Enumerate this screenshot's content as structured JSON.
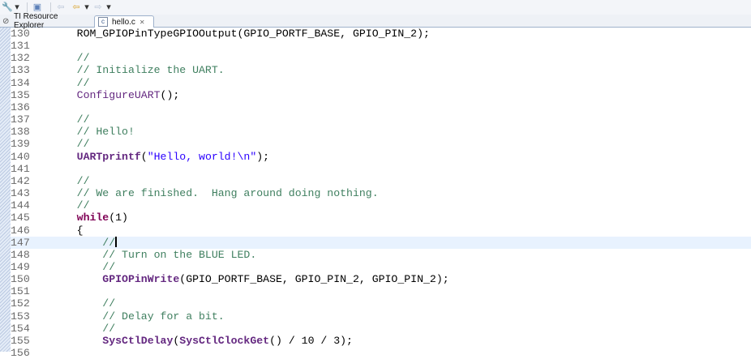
{
  "toolbar": {
    "items": [
      {
        "name": "pin-tool-icon",
        "glyph": "🔧"
      },
      {
        "name": "dropdown-chevron-icon",
        "glyph": "▾"
      },
      {
        "name": "show-whitespace-icon",
        "glyph": "▣"
      },
      {
        "name": "back-to-edit-icon",
        "glyph": "⇦"
      },
      {
        "name": "back-arrow-icon",
        "glyph": "⇦"
      },
      {
        "name": "back-dropdown-icon",
        "glyph": "▾"
      },
      {
        "name": "forward-arrow-icon",
        "glyph": "⇨"
      },
      {
        "name": "forward-dropdown-icon",
        "glyph": "▾"
      }
    ]
  },
  "tabs": [
    {
      "label": "TI Resource Explorer",
      "icon": "⊘",
      "active": false
    },
    {
      "label": "hello.c",
      "icon": "c",
      "close": "✕",
      "active": true
    }
  ],
  "editor": {
    "lines": [
      {
        "n": "130",
        "tokens": [
          {
            "t": "    ROM_GPIOPinTypeGPIOOutput(GPIO_PORTF_BASE, GPIO_PIN_2);",
            "c": "plain"
          }
        ]
      },
      {
        "n": "131",
        "tokens": []
      },
      {
        "n": "132",
        "tokens": [
          {
            "t": "    //",
            "c": "comment"
          }
        ]
      },
      {
        "n": "133",
        "tokens": [
          {
            "t": "    // Initialize the UART.",
            "c": "comment"
          }
        ]
      },
      {
        "n": "134",
        "tokens": [
          {
            "t": "    //",
            "c": "comment"
          }
        ]
      },
      {
        "n": "135",
        "tokens": [
          {
            "t": "    ConfigureUART",
            "c": "fn-plain"
          },
          {
            "t": "();",
            "c": "plain"
          }
        ]
      },
      {
        "n": "136",
        "tokens": []
      },
      {
        "n": "137",
        "tokens": [
          {
            "t": "    //",
            "c": "comment"
          }
        ]
      },
      {
        "n": "138",
        "tokens": [
          {
            "t": "    // Hello!",
            "c": "comment"
          }
        ]
      },
      {
        "n": "139",
        "tokens": [
          {
            "t": "    //",
            "c": "comment"
          }
        ]
      },
      {
        "n": "140",
        "tokens": [
          {
            "t": "    UARTprintf",
            "c": "fn"
          },
          {
            "t": "(",
            "c": "plain"
          },
          {
            "t": "\"Hello, world!\\n\"",
            "c": "str"
          },
          {
            "t": ");",
            "c": "plain"
          }
        ]
      },
      {
        "n": "141",
        "tokens": []
      },
      {
        "n": "142",
        "tokens": [
          {
            "t": "    //",
            "c": "comment"
          }
        ]
      },
      {
        "n": "143",
        "tokens": [
          {
            "t": "    // We are finished.  Hang around doing nothing.",
            "c": "comment"
          }
        ]
      },
      {
        "n": "144",
        "tokens": [
          {
            "t": "    //",
            "c": "comment"
          }
        ]
      },
      {
        "n": "145",
        "tokens": [
          {
            "t": "    while",
            "c": "kw"
          },
          {
            "t": "(1)",
            "c": "plain"
          }
        ]
      },
      {
        "n": "146",
        "tokens": [
          {
            "t": "    {",
            "c": "plain"
          }
        ]
      },
      {
        "n": "147",
        "tokens": [
          {
            "t": "        //",
            "c": "comment"
          }
        ],
        "current": true
      },
      {
        "n": "148",
        "tokens": [
          {
            "t": "        // Turn on the BLUE LED.",
            "c": "comment"
          }
        ]
      },
      {
        "n": "149",
        "tokens": [
          {
            "t": "        //",
            "c": "comment"
          }
        ]
      },
      {
        "n": "150",
        "tokens": [
          {
            "t": "        GPIOPinWrite",
            "c": "fn"
          },
          {
            "t": "(GPIO_PORTF_BASE, GPIO_PIN_2, GPIO_PIN_2);",
            "c": "plain"
          }
        ]
      },
      {
        "n": "151",
        "tokens": []
      },
      {
        "n": "152",
        "tokens": [
          {
            "t": "        //",
            "c": "comment"
          }
        ]
      },
      {
        "n": "153",
        "tokens": [
          {
            "t": "        // Delay for a bit.",
            "c": "comment"
          }
        ]
      },
      {
        "n": "154",
        "tokens": [
          {
            "t": "        //",
            "c": "comment"
          }
        ]
      },
      {
        "n": "155",
        "tokens": [
          {
            "t": "        SysCtlDelay",
            "c": "fn"
          },
          {
            "t": "(",
            "c": "plain"
          },
          {
            "t": "SysCtlClockGet",
            "c": "fn"
          },
          {
            "t": "() / 10 / 3);",
            "c": "plain"
          }
        ]
      },
      {
        "n": "156",
        "tokens": []
      }
    ]
  },
  "colors": {
    "comment": "#3f7f5f",
    "keyword": "#7f0055",
    "function": "#642880",
    "string": "#2a00ff",
    "current_line": "#e8f2fe"
  }
}
